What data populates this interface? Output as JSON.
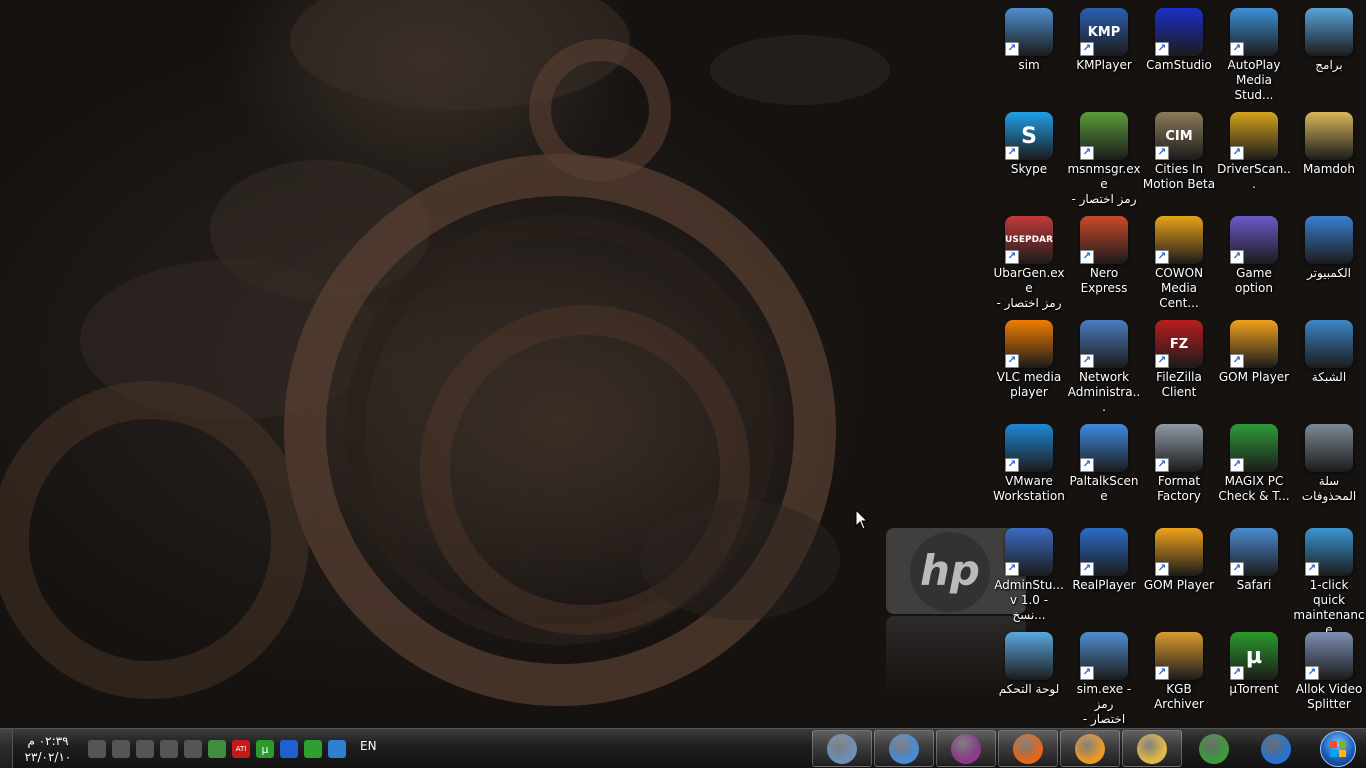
{
  "desktop": {
    "wallpaper": {
      "logo_text": "hp"
    },
    "icons": [
      {
        "label": "sim",
        "icon": "sim-shield-icon",
        "color": "#4f8ecf",
        "shortcut": true
      },
      {
        "label": "KMPlayer",
        "icon": "kmplayer-icon",
        "color": "#2a5fb0",
        "shortcut": true,
        "glyph": "KMP"
      },
      {
        "label": "CamStudio",
        "icon": "camstudio-icon",
        "color": "#1b2fc7",
        "shortcut": true
      },
      {
        "label": "AutoPlay\nMedia Stud...",
        "icon": "autoplay-disc-icon",
        "color": "#3d8fd8",
        "shortcut": true
      },
      {
        "label": "برامج",
        "icon": "programs-folder-icon",
        "color": "#5aa4d8",
        "shortcut": false
      },
      {
        "label": "Skype",
        "icon": "skype-icon",
        "color": "#1ea0e6",
        "shortcut": true,
        "glyph": "S"
      },
      {
        "label": "msnmsgr.exe\n- رمز اختصار",
        "icon": "msn-messenger-icon",
        "color": "#5b9b3a",
        "shortcut": true
      },
      {
        "label": "Cities In\nMotion Beta",
        "icon": "cities-in-motion-icon",
        "color": "#8c7a5a",
        "shortcut": true,
        "glyph": "CIM"
      },
      {
        "label": "DriverScan...",
        "icon": "driverscanner-icon",
        "color": "#d4a31b",
        "shortcut": true
      },
      {
        "label": "Mamdoh",
        "icon": "user-folder-icon",
        "color": "#d9b65a",
        "shortcut": false
      },
      {
        "label": "UbarGen.exe\n- رمز اختصار",
        "icon": "ubargen-icon",
        "color": "#c23a3a",
        "shortcut": true,
        "glyph": "USEPDAR"
      },
      {
        "label": "Nero Express",
        "icon": "nero-flame-icon",
        "color": "#c94a2a",
        "shortcut": true
      },
      {
        "label": "COWON\nMedia Cent...",
        "icon": "cowon-icon",
        "color": "#e8a21a",
        "shortcut": true
      },
      {
        "label": "Game option",
        "icon": "gamepad-icon",
        "color": "#6b5ac8",
        "shortcut": true
      },
      {
        "label": "الكمبيوتر",
        "icon": "computer-icon",
        "color": "#3a7fd0",
        "shortcut": false
      },
      {
        "label": "VLC media\nplayer",
        "icon": "vlc-cone-icon",
        "color": "#f07d00",
        "shortcut": true
      },
      {
        "label": "Network\nAdministra...",
        "icon": "network-admin-icon",
        "color": "#4a7cbf",
        "shortcut": true
      },
      {
        "label": "FileZilla\nClient",
        "icon": "filezilla-icon",
        "color": "#b81d1d",
        "shortcut": true,
        "glyph": "FZ"
      },
      {
        "label": "GOM Player",
        "icon": "gom-player-icon",
        "color": "#f0a21c",
        "shortcut": true
      },
      {
        "label": "الشبكة",
        "icon": "network-globe-icon",
        "color": "#3d86c6",
        "shortcut": false
      },
      {
        "label": "VMware\nWorkstation",
        "icon": "vmware-icon",
        "color": "#1f87d6",
        "shortcut": true
      },
      {
        "label": "PaltalkScene",
        "icon": "paltalk-icon",
        "color": "#3e8be0",
        "shortcut": true
      },
      {
        "label": "Format\nFactory",
        "icon": "format-factory-icon",
        "color": "#8f9aa6",
        "shortcut": true
      },
      {
        "label": "MAGIX PC\nCheck & T...",
        "icon": "magix-icon",
        "color": "#2f9a3a",
        "shortcut": true
      },
      {
        "label": "سلة المحذوفات",
        "icon": "recycle-bin-icon",
        "color": "#7c8a96",
        "shortcut": false
      },
      {
        "label": "AdminStu...\nv 1.0 - نسخ...",
        "icon": "adminstudio-icon",
        "color": "#3c6bc4",
        "shortcut": true
      },
      {
        "label": "RealPlayer",
        "icon": "realplayer-icon",
        "color": "#2b6cc7",
        "shortcut": true
      },
      {
        "label": "GOM Player",
        "icon": "gom-player-icon",
        "color": "#f0a21c",
        "shortcut": true
      },
      {
        "label": "Safari",
        "icon": "safari-compass-icon",
        "color": "#4b8bd0",
        "shortcut": true
      },
      {
        "label": "1-click quick\nmaintenance",
        "icon": "quick-maintenance-icon",
        "color": "#3a96d0",
        "shortcut": true
      },
      {
        "label": "لوحة التحكم",
        "icon": "control-panel-icon",
        "color": "#5aa8e0",
        "shortcut": false
      },
      {
        "label": "sim.exe - رمز\nاختصار - نسخة",
        "icon": "sim-shield-icon",
        "color": "#4f8ecf",
        "shortcut": true
      },
      {
        "label": "KGB Archiver",
        "icon": "kgb-archiver-icon",
        "color": "#d99a2e",
        "shortcut": true
      },
      {
        "label": "µTorrent",
        "icon": "utorrent-icon",
        "color": "#2b9a2b",
        "shortcut": true,
        "glyph": "µ"
      },
      {
        "label": "Allok Video\nSplitter",
        "icon": "allok-splitter-icon",
        "color": "#7d8fb3",
        "shortcut": true
      }
    ]
  },
  "taskbar": {
    "clock": {
      "time": "٠٢:٣٩ م",
      "date": "٢٣/٠٢/١٠"
    },
    "language": "EN",
    "tray": [
      {
        "icon": "signal-bars-icon",
        "color": "#555555"
      },
      {
        "icon": "volume-icon",
        "color": "#555555"
      },
      {
        "icon": "power-plug-icon",
        "color": "#555555"
      },
      {
        "icon": "action-center-flag-icon",
        "color": "#555555"
      },
      {
        "icon": "network-monitor-icon",
        "color": "#555555"
      },
      {
        "icon": "green-tray-icon",
        "color": "#3f8f3f"
      },
      {
        "icon": "ati-icon",
        "color": "#c41a1a",
        "glyph": "ATI"
      },
      {
        "icon": "utorrent-tray-icon",
        "color": "#2b9a2b",
        "glyph": "µ"
      },
      {
        "icon": "bluetooth-icon",
        "color": "#1f5fd0"
      },
      {
        "icon": "green-check-icon",
        "color": "#2fa02f"
      },
      {
        "icon": "blue-window-icon",
        "color": "#2f7fd0"
      }
    ],
    "pinned": [
      {
        "icon": "wordpad-icon",
        "color": "#6f8fb8",
        "active": true
      },
      {
        "icon": "safari-compass-icon",
        "color": "#4b8bd0",
        "active": true
      },
      {
        "icon": "winrar-icon",
        "color": "#8a3a8a",
        "active": true
      },
      {
        "icon": "firefox-icon",
        "color": "#e2681b",
        "active": true
      },
      {
        "icon": "media-player-icon",
        "color": "#e89a2a",
        "active": true
      },
      {
        "icon": "explorer-folder-icon",
        "color": "#e0b84a",
        "active": true
      },
      {
        "icon": "chrome-icon",
        "color": "#3f9a3f",
        "active": false
      },
      {
        "icon": "internet-explorer-icon",
        "color": "#2a74d0",
        "active": false
      }
    ],
    "start": {
      "icon": "windows-start-orb-icon"
    }
  }
}
